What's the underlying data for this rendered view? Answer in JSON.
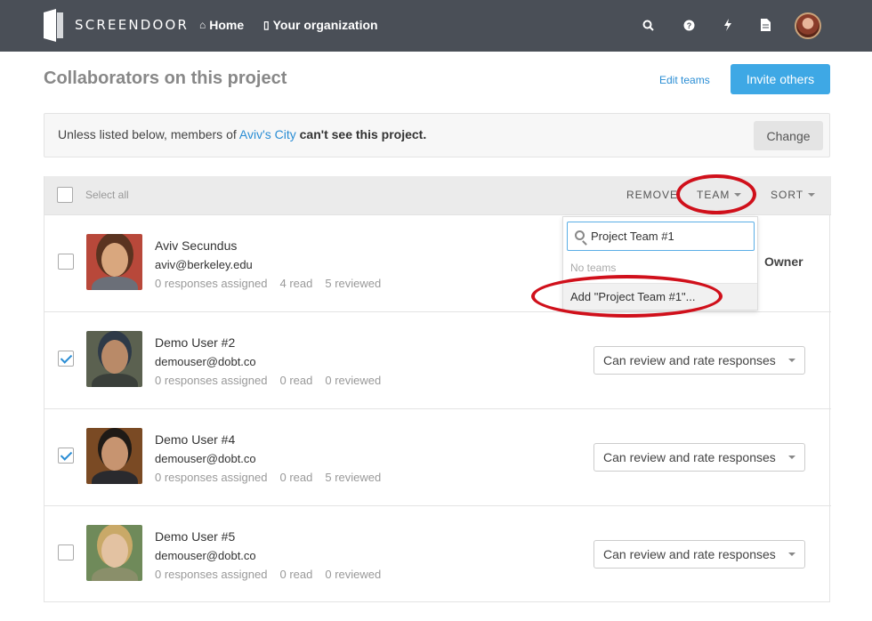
{
  "nav": {
    "brand": "SCREENDOOR",
    "home_icon": "home-icon",
    "home_label": "Home",
    "org_icon": "building-icon",
    "org_label": "Your organization",
    "icons": [
      "search-icon",
      "help-icon",
      "bolt-icon",
      "document-icon",
      "user-avatar"
    ]
  },
  "header": {
    "title": "Collaborators on this project",
    "edit_teams": "Edit teams",
    "invite": "Invite others"
  },
  "notice": {
    "prefix": "Unless listed below, members of ",
    "org": "Aviv's City",
    "suffix": " can't see this project.",
    "change": "Change"
  },
  "list_head": {
    "select_all": "Select all",
    "remove": "REMOVE",
    "team": "TEAM",
    "sort": "SORT"
  },
  "team_dropdown": {
    "search_value": "Project Team #1",
    "empty": "No teams",
    "add_label": "Add \"Project Team #1\"..."
  },
  "users": [
    {
      "name": "Aviv Secundus",
      "email": "aviv@berkeley.edu",
      "assigned": "0 responses assigned",
      "read": "4 read",
      "reviewed": "5 reviewed",
      "checked": false,
      "role": "Owner"
    },
    {
      "name": "Demo User #2",
      "email": "demouser@dobt.co",
      "assigned": "0 responses assigned",
      "read": "0 read",
      "reviewed": "0 reviewed",
      "checked": true,
      "role": "Can review and rate responses"
    },
    {
      "name": "Demo User #4",
      "email": "demouser@dobt.co",
      "assigned": "0 responses assigned",
      "read": "0 read",
      "reviewed": "5 reviewed",
      "checked": true,
      "role": "Can review and rate responses"
    },
    {
      "name": "Demo User #5",
      "email": "demouser@dobt.co",
      "assigned": "0 responses assigned",
      "read": "0 read",
      "reviewed": "0 reviewed",
      "checked": false,
      "role": "Can review and rate responses"
    }
  ],
  "colors": {
    "nav": "#4a4f57",
    "accent": "#3ea8e5",
    "link": "#2a8dd4",
    "highlight_ring": "#d0101b"
  }
}
